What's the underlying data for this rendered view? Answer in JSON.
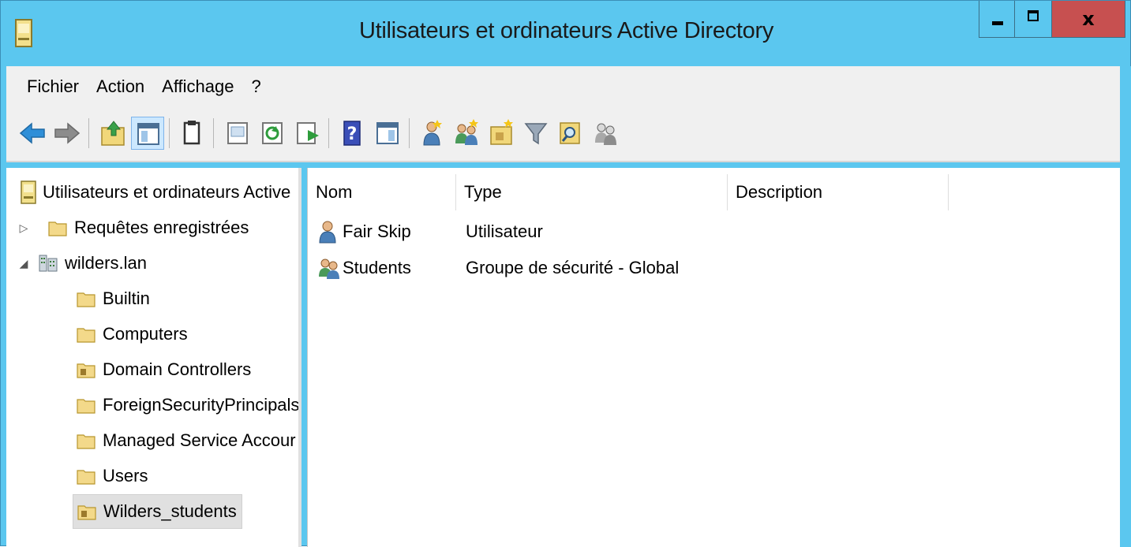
{
  "window": {
    "title": "Utilisateurs et ordinateurs Active Directory",
    "close_glyph": "x",
    "accent": "#5bc7ef",
    "close_color": "#c75050"
  },
  "menu": {
    "items": [
      "Fichier",
      "Action",
      "Affichage",
      "?"
    ]
  },
  "toolbar": {
    "icons": [
      "back-arrow-icon",
      "forward-arrow-icon",
      "up-folder-icon",
      "show-hide-console-tree-icon",
      "clipboard-icon",
      "properties-icon",
      "refresh-icon",
      "export-list-icon",
      "help-icon",
      "action-pane-icon",
      "new-user-icon",
      "new-group-icon",
      "new-ou-icon",
      "filter-icon",
      "find-icon",
      "add-to-group-icon"
    ]
  },
  "tree": {
    "root": "Utilisateurs et ordinateurs Active",
    "saved_queries": "Requêtes enregistrées",
    "domain": "wilders.lan",
    "expand_glyph": "▷",
    "collapse_glyph": "◢",
    "children": [
      "Builtin",
      "Computers",
      "Domain Controllers",
      "ForeignSecurityPrincipals",
      "Managed Service Accour",
      "Users",
      "Wilders_students"
    ]
  },
  "list": {
    "columns": {
      "name": "Nom",
      "type": "Type",
      "description": "Description"
    },
    "rows": [
      {
        "name": "Fair Skip",
        "type": "Utilisateur",
        "icon": "user-icon"
      },
      {
        "name": "Students",
        "type": "Groupe de sécurité - Global",
        "icon": "group-icon"
      }
    ]
  }
}
